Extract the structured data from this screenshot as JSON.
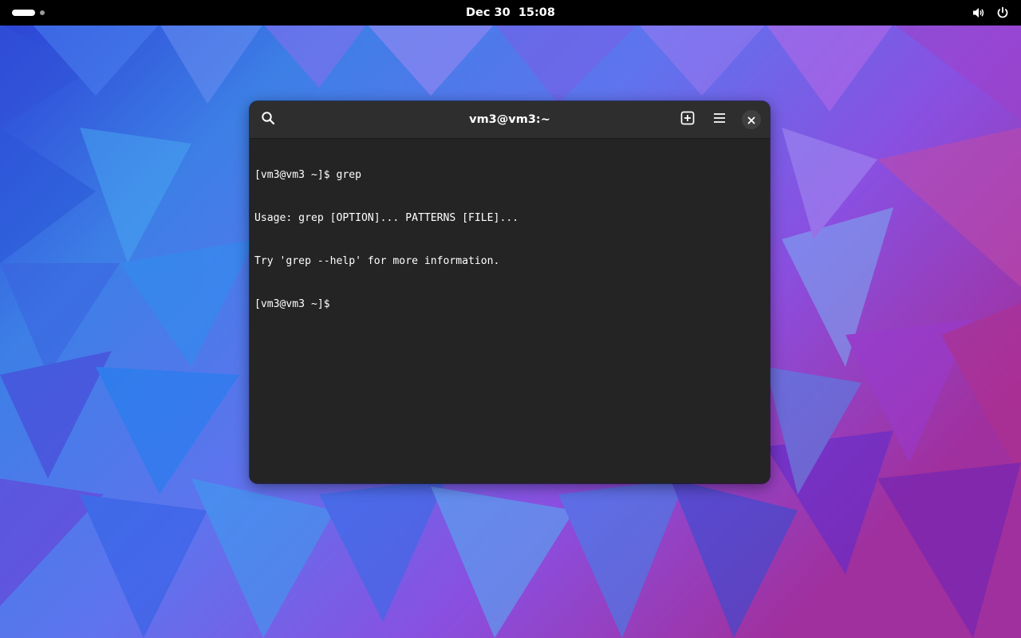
{
  "topbar": {
    "date": "Dec 30",
    "time": "15:08",
    "icons": [
      "activities-workspace-indicator",
      "volume-icon",
      "power-icon"
    ]
  },
  "terminal": {
    "title": "vm3@vm3:~",
    "icons": [
      "search-icon",
      "new-tab-icon",
      "hamburger-menu-icon",
      "close-icon"
    ],
    "lines": [
      "[vm3@vm3 ~]$ grep",
      "Usage: grep [OPTION]... PATTERNS [FILE]...",
      "Try 'grep --help' for more information.",
      "[vm3@vm3 ~]$ "
    ]
  },
  "colors": {
    "topbar_bg": "#000000",
    "terminal_bg": "#242424",
    "headerbar_bg": "#2e2e2e",
    "text": "#ffffff"
  }
}
